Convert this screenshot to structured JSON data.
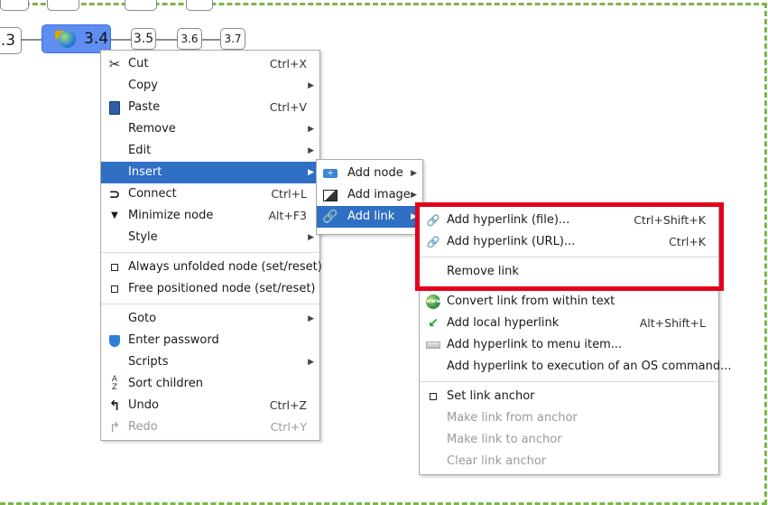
{
  "mindmap": {
    "nodes_top": [
      "",
      "",
      "",
      ""
    ],
    "node_prev": ".3",
    "selected_node": "3.4",
    "sibling_nodes": [
      "3.5",
      "3.6",
      "3.7"
    ]
  },
  "context_menu": {
    "items": [
      {
        "label": "Cut",
        "shortcut": "Ctrl+X",
        "icon": "scissors-icon"
      },
      {
        "label": "Copy",
        "submenu": true
      },
      {
        "label": "Paste",
        "shortcut": "Ctrl+V",
        "icon": "clipboard-icon"
      },
      {
        "label": "Remove",
        "submenu": true
      },
      {
        "label": "Edit",
        "submenu": true
      },
      {
        "label": "Insert",
        "submenu": true,
        "highlighted": true
      },
      {
        "label": "Connect",
        "shortcut": "Ctrl+L",
        "icon": "connect-icon"
      },
      {
        "label": "Minimize node",
        "shortcut": "Alt+F3",
        "icon": "triangle-down-icon"
      },
      {
        "label": "Style",
        "submenu": true
      },
      {
        "label": "Always unfolded node (set/reset)",
        "icon": "checkbox-icon"
      },
      {
        "label": "Free positioned node (set/reset)",
        "icon": "checkbox-icon"
      },
      {
        "label": "Goto",
        "submenu": true
      },
      {
        "label": "Enter password",
        "icon": "shield-icon"
      },
      {
        "label": "Scripts",
        "submenu": true
      },
      {
        "label": "Sort children",
        "icon": "sort-az-icon"
      },
      {
        "label": "Undo",
        "shortcut": "Ctrl+Z",
        "icon": "undo-icon"
      },
      {
        "label": "Redo",
        "shortcut": "Ctrl+Y",
        "icon": "redo-icon",
        "disabled": true
      }
    ]
  },
  "insert_submenu": {
    "items": [
      {
        "label": "Add node",
        "icon": "add-node-icon"
      },
      {
        "label": "Add image",
        "icon": "image-icon"
      },
      {
        "label": "Add link",
        "icon": "link-icon",
        "highlighted": true
      }
    ]
  },
  "link_submenu": {
    "items": [
      {
        "label": "Add hyperlink (file)...",
        "shortcut": "Ctrl+Shift+K",
        "icon": "link-icon"
      },
      {
        "label": "Add hyperlink (URL)...",
        "shortcut": "Ctrl+K",
        "icon": "link-url-icon"
      },
      {
        "label": "Remove link"
      },
      {
        "label": "Convert link from within text",
        "icon": "www-globe-icon"
      },
      {
        "label": "Add local hyperlink",
        "shortcut": "Alt+Shift+L",
        "icon": "green-arrow-icon"
      },
      {
        "label": "Add hyperlink to menu item...",
        "icon": "menu-bar-icon"
      },
      {
        "label": "Add hyperlink to execution of an OS command..."
      },
      {
        "label": "Set link anchor",
        "icon": "checkbox-icon"
      },
      {
        "label": "Make link from anchor",
        "disabled": true
      },
      {
        "label": "Make link to anchor",
        "disabled": true
      },
      {
        "label": "Clear link anchor",
        "disabled": true
      }
    ]
  },
  "colors": {
    "highlight": "#2f6fc4",
    "selected_node": "#5d8ef0",
    "annotation_box": "#e3001b",
    "canvas_border": "#7ab648"
  }
}
